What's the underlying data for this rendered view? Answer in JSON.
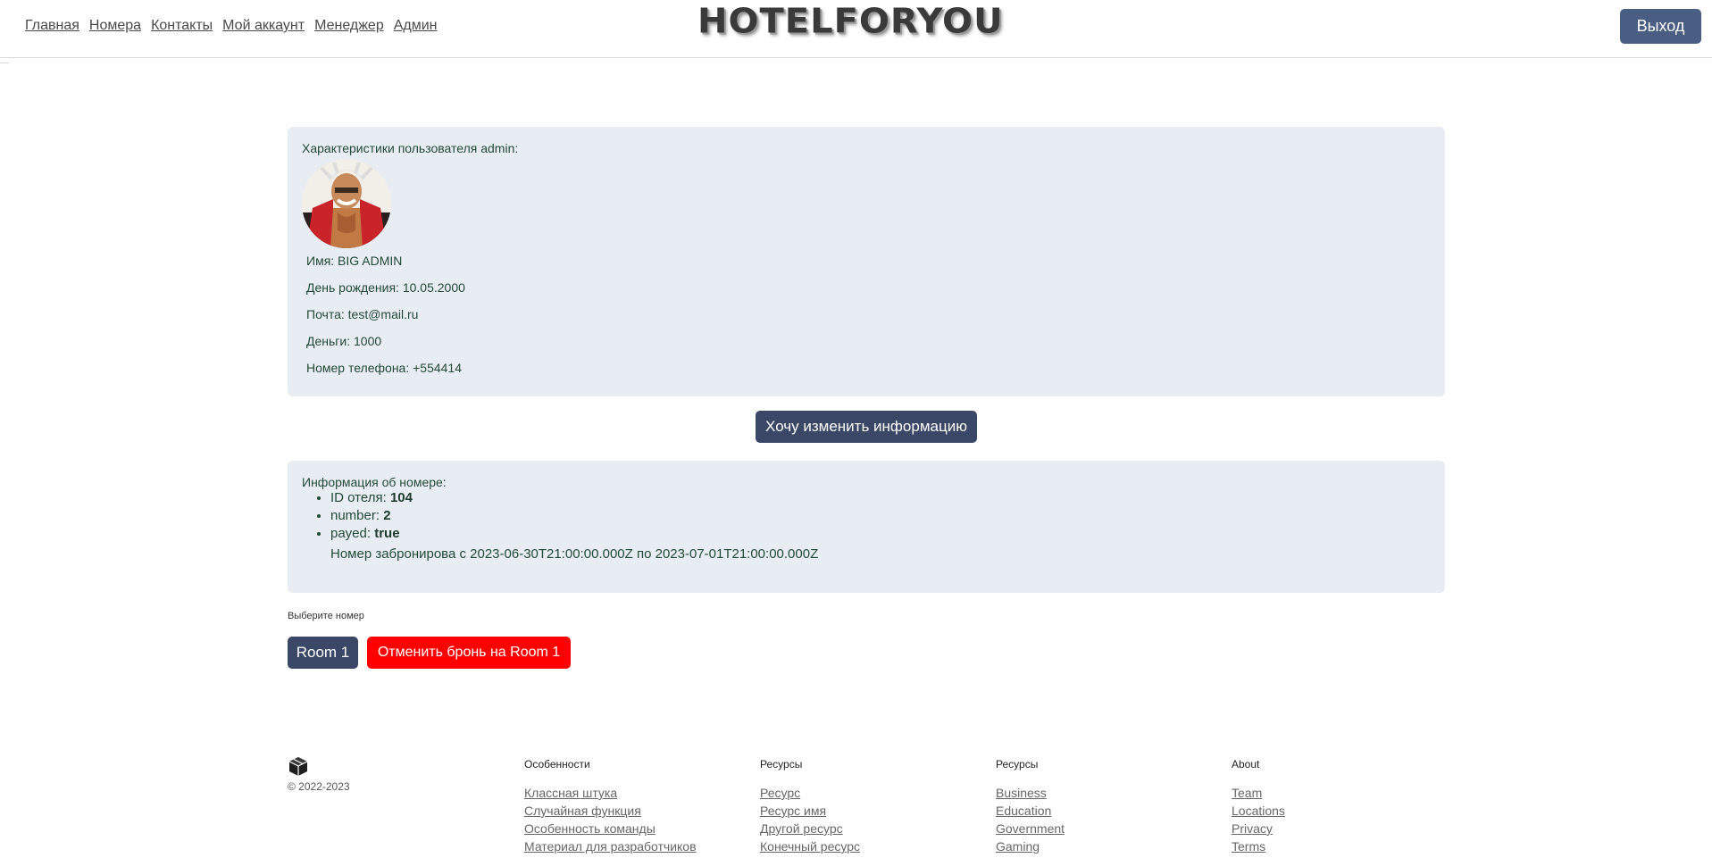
{
  "header": {
    "nav": [
      {
        "label": "Главная"
      },
      {
        "label": "Номера"
      },
      {
        "label": "Контакты"
      },
      {
        "label": "Мой аккаунт"
      },
      {
        "label": "Менеджер"
      },
      {
        "label": "Админ"
      }
    ],
    "logo_text": "HOTELFORYOU",
    "logout_label": "Выход"
  },
  "user": {
    "title": "Характеристики пользователя admin:",
    "avatar_icon": "avatar-image",
    "fields": [
      {
        "text": "Имя: BIG ADMIN"
      },
      {
        "text": "День рождения: 10.05.2000"
      },
      {
        "text": "Почта: test@mail.ru"
      },
      {
        "text": "Деньги: 1000"
      },
      {
        "text": "Номер телефона: +554414"
      }
    ],
    "edit_label": "Хочу изменить информацию"
  },
  "room_info": {
    "title": "Информация об номере:",
    "items": [
      {
        "key": "ID отеля: ",
        "value": "104"
      },
      {
        "key": "number: ",
        "value": "2"
      },
      {
        "key": "payed: ",
        "value": "true"
      }
    ],
    "booking": "Номер забронирова с 2023-06-30T21:00:00.000Z по 2023-07-01T21:00:00.000Z"
  },
  "choose": {
    "label": "Выберите номер",
    "room_label": "Room 1",
    "cancel_label": "Отменить бронь на Room 1"
  },
  "footer": {
    "brand_icon": "cube-icon",
    "copyright": "© 2022-2023",
    "columns": [
      {
        "title": "Особенности",
        "links": [
          "Классная штука",
          "Случайная функция",
          "Особенность команды",
          "Материал для разработчиков"
        ]
      },
      {
        "title": "Ресурсы",
        "links": [
          "Ресурс",
          "Ресурс имя",
          "Другой ресурс",
          "Конечный ресурс"
        ]
      },
      {
        "title": "Ресурсы",
        "links": [
          "Business",
          "Education",
          "Government",
          "Gaming"
        ]
      },
      {
        "title": "About",
        "links": [
          "Team",
          "Locations",
          "Privacy",
          "Terms"
        ]
      }
    ]
  },
  "colors": {
    "primary": "#3b4766",
    "logout": "#4a5d82",
    "danger": "#ff0000",
    "panel_bg": "#e8edf4",
    "panel_text": "#234a36"
  }
}
